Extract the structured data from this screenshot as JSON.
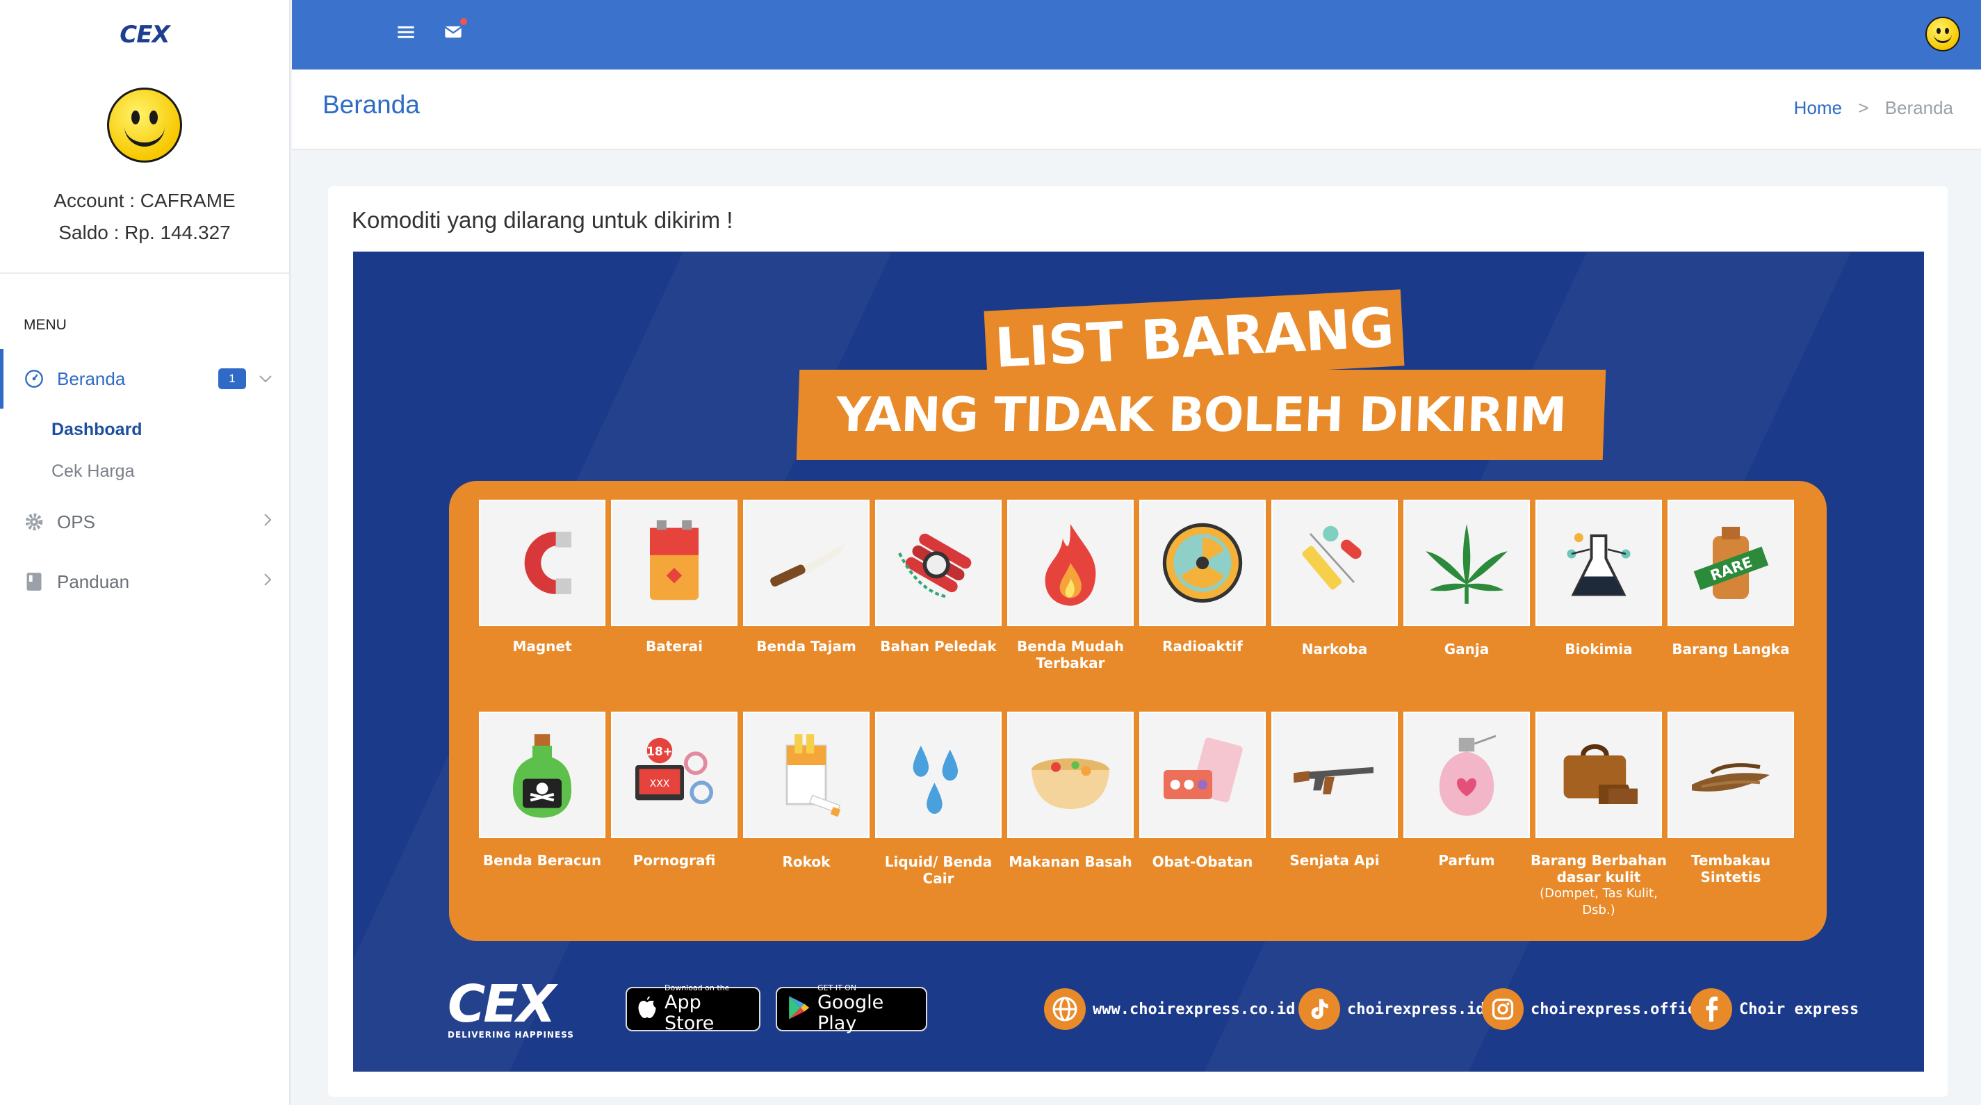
{
  "brand": {
    "logo_text": "CEX"
  },
  "profile": {
    "account": "Account : CAFRAME",
    "saldo": "Saldo : Rp. 144.327"
  },
  "sidebar": {
    "menu_title": "MENU",
    "items": [
      {
        "label": "Beranda",
        "badge": "1",
        "icon": "dashboard-icon",
        "sub": [
          {
            "label": "Dashboard"
          },
          {
            "label": "Cek Harga"
          }
        ]
      },
      {
        "label": "OPS",
        "icon": "gear-icon"
      },
      {
        "label": "Panduan",
        "icon": "book-icon"
      }
    ]
  },
  "header": {
    "title": "Beranda",
    "breadcrumb": [
      "Home",
      "Beranda"
    ]
  },
  "card": {
    "title": "Komoditi yang dilarang untuk dikirim !"
  },
  "poster": {
    "title_line1": "LIST BARANG",
    "title_line2": "YANG TIDAK BOLEH DIKIRIM",
    "row1": [
      "Magnet",
      "Baterai",
      "Benda Tajam",
      "Bahan Peledak",
      "Benda Mudah Terbakar",
      "Radioaktif",
      "Narkoba",
      "Ganja",
      "Biokimia",
      "Barang Langka"
    ],
    "row2": [
      "Benda Beracun",
      "Pornografi",
      "Rokok",
      "Liquid/ Benda Cair",
      "Makanan Basah",
      "Obat-Obatan",
      "Senjata Api",
      "Parfum",
      "Barang Berbahan dasar kulit",
      "Tembakau Sintetis"
    ],
    "row2_note": "(Dompet, Tas Kulit, Dsb.)",
    "rare_stamp": "RARE",
    "age_badge": "18+",
    "xxx_label": "XXX",
    "logo_text": "CEX",
    "tagline": "DELIVERING HAPPINESS",
    "appstore": {
      "small": "Download on the",
      "large": "App Store"
    },
    "googleplay": {
      "small": "GET IT ON",
      "large": "Google Play"
    },
    "social": {
      "website": "www.choirexpress.co.id",
      "tiktok": "choirexpress.id",
      "instagram": "choirexpress.official",
      "facebook": "Choir express"
    },
    "colors": {
      "navy": "#1c3a8a",
      "orange": "#e88a2a"
    }
  },
  "colors": {
    "primary": "#3b73cc",
    "accent": "#2f6bc6"
  }
}
